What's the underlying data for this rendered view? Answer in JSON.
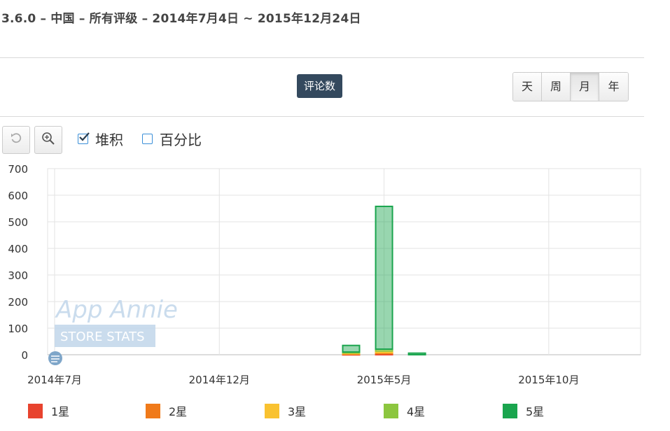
{
  "header": {
    "title": "3.6.0 – 中国 – 所有评级 – 2014年7月4日 ~ 2015年12月24日"
  },
  "metric_label": "评论数",
  "periods": [
    {
      "label": "天",
      "active": false
    },
    {
      "label": "周",
      "active": false
    },
    {
      "label": "月",
      "active": true
    },
    {
      "label": "年",
      "active": false
    }
  ],
  "options": {
    "stacked": {
      "label": "堆积",
      "checked": true
    },
    "percent": {
      "label": "百分比",
      "checked": false
    }
  },
  "watermark": {
    "line1": "App Annie",
    "line2": "STORE STATS"
  },
  "legend": [
    {
      "label": "1星",
      "color": "#e8432e"
    },
    {
      "label": "2星",
      "color": "#f07a1a"
    },
    {
      "label": "3星",
      "color": "#f9c230"
    },
    {
      "label": "4星",
      "color": "#8cc63f"
    },
    {
      "label": "5星",
      "color": "#1aa54e"
    }
  ],
  "chart_data": {
    "type": "bar",
    "stacked": true,
    "x_ticks": [
      "2014年7月",
      "2014年12月",
      "2015年5月",
      "2015年10月"
    ],
    "y_ticks": [
      "0",
      "100",
      "200",
      "300",
      "400",
      "500",
      "600",
      "700"
    ],
    "ylim": [
      0,
      700
    ],
    "grid": true,
    "legend_position": "bottom",
    "categories": [
      "2015年4月",
      "2015年5月",
      "2015年6月"
    ],
    "series": [
      {
        "name": "1星",
        "values": [
          2,
          4,
          0
        ]
      },
      {
        "name": "2星",
        "values": [
          2,
          4,
          0
        ]
      },
      {
        "name": "3星",
        "values": [
          3,
          6,
          0
        ]
      },
      {
        "name": "4星",
        "values": [
          3,
          7,
          0
        ]
      },
      {
        "name": "5星",
        "values": [
          25,
          537,
          6
        ]
      }
    ]
  }
}
